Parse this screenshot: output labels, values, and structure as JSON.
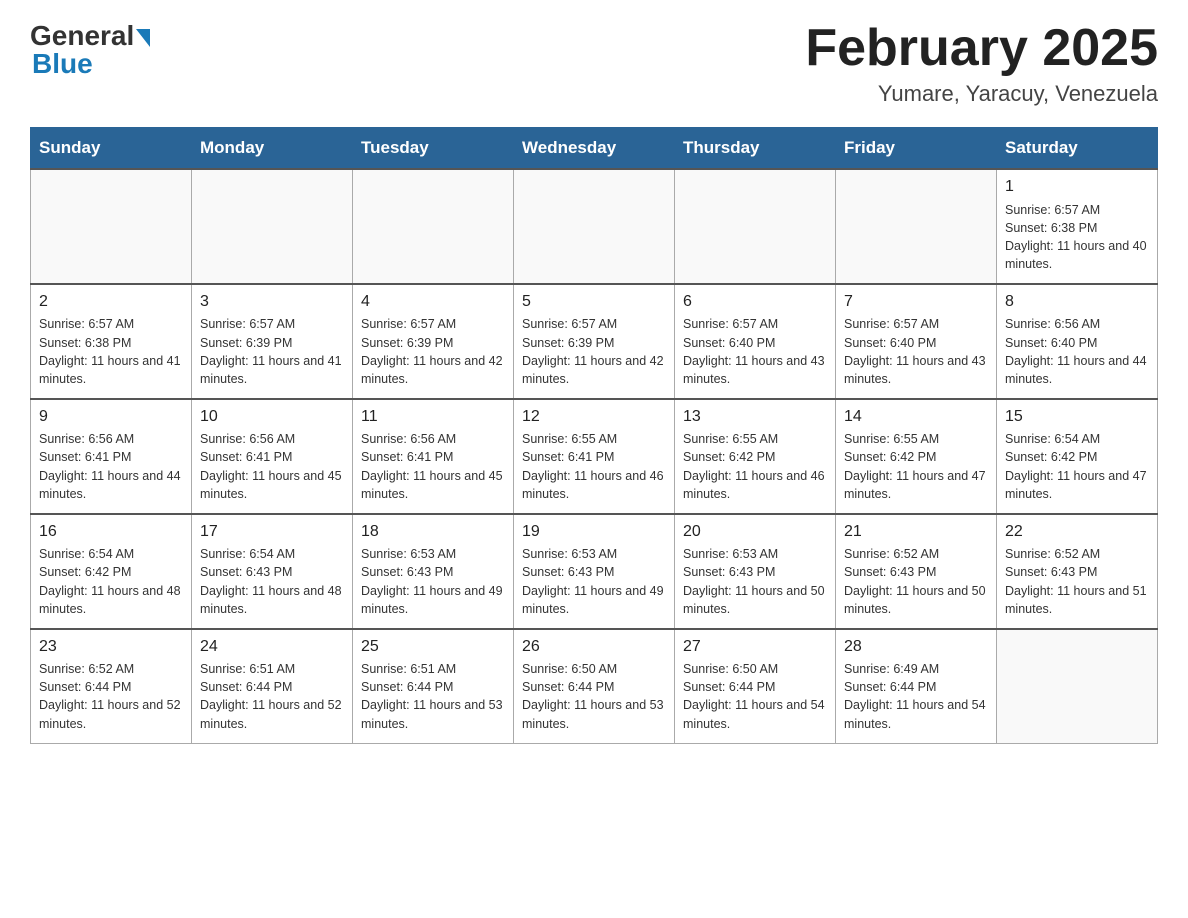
{
  "header": {
    "logo_general": "General",
    "logo_blue": "Blue",
    "month_title": "February 2025",
    "location": "Yumare, Yaracuy, Venezuela"
  },
  "calendar": {
    "days_of_week": [
      "Sunday",
      "Monday",
      "Tuesday",
      "Wednesday",
      "Thursday",
      "Friday",
      "Saturday"
    ],
    "weeks": [
      {
        "days": [
          {
            "number": "",
            "info": ""
          },
          {
            "number": "",
            "info": ""
          },
          {
            "number": "",
            "info": ""
          },
          {
            "number": "",
            "info": ""
          },
          {
            "number": "",
            "info": ""
          },
          {
            "number": "",
            "info": ""
          },
          {
            "number": "1",
            "info": "Sunrise: 6:57 AM\nSunset: 6:38 PM\nDaylight: 11 hours and 40 minutes."
          }
        ]
      },
      {
        "days": [
          {
            "number": "2",
            "info": "Sunrise: 6:57 AM\nSunset: 6:38 PM\nDaylight: 11 hours and 41 minutes."
          },
          {
            "number": "3",
            "info": "Sunrise: 6:57 AM\nSunset: 6:39 PM\nDaylight: 11 hours and 41 minutes."
          },
          {
            "number": "4",
            "info": "Sunrise: 6:57 AM\nSunset: 6:39 PM\nDaylight: 11 hours and 42 minutes."
          },
          {
            "number": "5",
            "info": "Sunrise: 6:57 AM\nSunset: 6:39 PM\nDaylight: 11 hours and 42 minutes."
          },
          {
            "number": "6",
            "info": "Sunrise: 6:57 AM\nSunset: 6:40 PM\nDaylight: 11 hours and 43 minutes."
          },
          {
            "number": "7",
            "info": "Sunrise: 6:57 AM\nSunset: 6:40 PM\nDaylight: 11 hours and 43 minutes."
          },
          {
            "number": "8",
            "info": "Sunrise: 6:56 AM\nSunset: 6:40 PM\nDaylight: 11 hours and 44 minutes."
          }
        ]
      },
      {
        "days": [
          {
            "number": "9",
            "info": "Sunrise: 6:56 AM\nSunset: 6:41 PM\nDaylight: 11 hours and 44 minutes."
          },
          {
            "number": "10",
            "info": "Sunrise: 6:56 AM\nSunset: 6:41 PM\nDaylight: 11 hours and 45 minutes."
          },
          {
            "number": "11",
            "info": "Sunrise: 6:56 AM\nSunset: 6:41 PM\nDaylight: 11 hours and 45 minutes."
          },
          {
            "number": "12",
            "info": "Sunrise: 6:55 AM\nSunset: 6:41 PM\nDaylight: 11 hours and 46 minutes."
          },
          {
            "number": "13",
            "info": "Sunrise: 6:55 AM\nSunset: 6:42 PM\nDaylight: 11 hours and 46 minutes."
          },
          {
            "number": "14",
            "info": "Sunrise: 6:55 AM\nSunset: 6:42 PM\nDaylight: 11 hours and 47 minutes."
          },
          {
            "number": "15",
            "info": "Sunrise: 6:54 AM\nSunset: 6:42 PM\nDaylight: 11 hours and 47 minutes."
          }
        ]
      },
      {
        "days": [
          {
            "number": "16",
            "info": "Sunrise: 6:54 AM\nSunset: 6:42 PM\nDaylight: 11 hours and 48 minutes."
          },
          {
            "number": "17",
            "info": "Sunrise: 6:54 AM\nSunset: 6:43 PM\nDaylight: 11 hours and 48 minutes."
          },
          {
            "number": "18",
            "info": "Sunrise: 6:53 AM\nSunset: 6:43 PM\nDaylight: 11 hours and 49 minutes."
          },
          {
            "number": "19",
            "info": "Sunrise: 6:53 AM\nSunset: 6:43 PM\nDaylight: 11 hours and 49 minutes."
          },
          {
            "number": "20",
            "info": "Sunrise: 6:53 AM\nSunset: 6:43 PM\nDaylight: 11 hours and 50 minutes."
          },
          {
            "number": "21",
            "info": "Sunrise: 6:52 AM\nSunset: 6:43 PM\nDaylight: 11 hours and 50 minutes."
          },
          {
            "number": "22",
            "info": "Sunrise: 6:52 AM\nSunset: 6:43 PM\nDaylight: 11 hours and 51 minutes."
          }
        ]
      },
      {
        "days": [
          {
            "number": "23",
            "info": "Sunrise: 6:52 AM\nSunset: 6:44 PM\nDaylight: 11 hours and 52 minutes."
          },
          {
            "number": "24",
            "info": "Sunrise: 6:51 AM\nSunset: 6:44 PM\nDaylight: 11 hours and 52 minutes."
          },
          {
            "number": "25",
            "info": "Sunrise: 6:51 AM\nSunset: 6:44 PM\nDaylight: 11 hours and 53 minutes."
          },
          {
            "number": "26",
            "info": "Sunrise: 6:50 AM\nSunset: 6:44 PM\nDaylight: 11 hours and 53 minutes."
          },
          {
            "number": "27",
            "info": "Sunrise: 6:50 AM\nSunset: 6:44 PM\nDaylight: 11 hours and 54 minutes."
          },
          {
            "number": "28",
            "info": "Sunrise: 6:49 AM\nSunset: 6:44 PM\nDaylight: 11 hours and 54 minutes."
          },
          {
            "number": "",
            "info": ""
          }
        ]
      }
    ]
  }
}
